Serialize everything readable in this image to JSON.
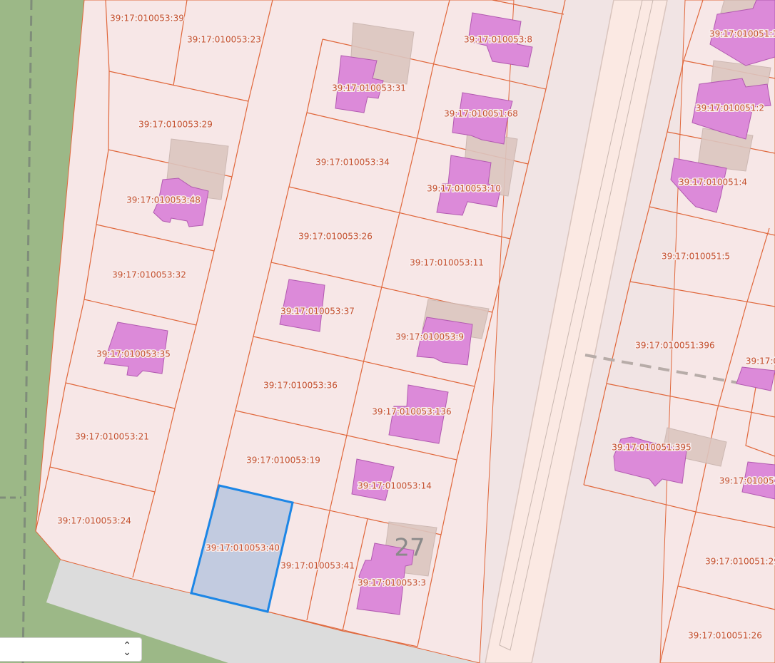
{
  "map": {
    "colors": {
      "background": "#f1e4e4",
      "green_area": "#9cb887",
      "road": "#fbe9e3",
      "road_edge": "#d9c4bd",
      "sidewalk": "#dcdcdc",
      "parcel_fill": "#f7e7e7",
      "parcel_border": "#e0673b",
      "building": "#dc8ad9",
      "building_border": "#b25ab0",
      "old_building": "#dcc6c0",
      "selected_fill": "#c2cbe0",
      "selected_border": "#1c86e6",
      "label_text": "#c4502e"
    },
    "parcels": [
      {
        "id": "39:17:010053:39",
        "selected": false
      },
      {
        "id": "39:17:010053:23",
        "selected": false
      },
      {
        "id": "39:17:010053:8",
        "selected": false
      },
      {
        "id": "39:17:010051:1",
        "selected": false
      },
      {
        "id": "39:17:010053:31",
        "selected": false
      },
      {
        "id": "39:17:010051:68",
        "selected": false
      },
      {
        "id": "39:17:010051:2",
        "selected": false
      },
      {
        "id": "39:17:010053:29",
        "selected": false
      },
      {
        "id": "39:17:010053:34",
        "selected": false
      },
      {
        "id": "39:17:010053:10",
        "selected": false
      },
      {
        "id": "39:17:010053:48",
        "selected": false
      },
      {
        "id": "39:17:010051:4",
        "selected": false
      },
      {
        "id": "39:17:010053:26",
        "selected": false
      },
      {
        "id": "39:17:010051:5",
        "selected": false
      },
      {
        "id": "39:17:010053:11",
        "selected": false
      },
      {
        "id": "39:17:010053:32",
        "selected": false
      },
      {
        "id": "39:17:010053:37",
        "selected": false
      },
      {
        "id": "39:17:010053:9",
        "selected": false
      },
      {
        "id": "39:17:010053:35",
        "selected": false
      },
      {
        "id": "39:17:010051:396",
        "selected": false
      },
      {
        "id": "39:17:0",
        "selected": false
      },
      {
        "id": "39:17:010053:36",
        "selected": false
      },
      {
        "id": "39:17:010053:136",
        "selected": false
      },
      {
        "id": "39:17:010053:21",
        "selected": false
      },
      {
        "id": "39:17:010051:395",
        "selected": false
      },
      {
        "id": "39:17:010053:19",
        "selected": false
      },
      {
        "id": "39:17:010051",
        "selected": false
      },
      {
        "id": "39:17:010053:14",
        "selected": false
      },
      {
        "id": "39:17:010053:24",
        "selected": false
      },
      {
        "id": "39:17:010053:40",
        "selected": true
      },
      {
        "id": "39:17:010053:41",
        "selected": false
      },
      {
        "id": "39:17:010051:29",
        "selected": false
      },
      {
        "id": "39:17:010053:3",
        "selected": false
      },
      {
        "id": "39:17:010051:26",
        "selected": false
      }
    ],
    "house_number": "27"
  },
  "layer_select": {
    "value": "",
    "arrows_icon": "updown-chevron-icon"
  }
}
